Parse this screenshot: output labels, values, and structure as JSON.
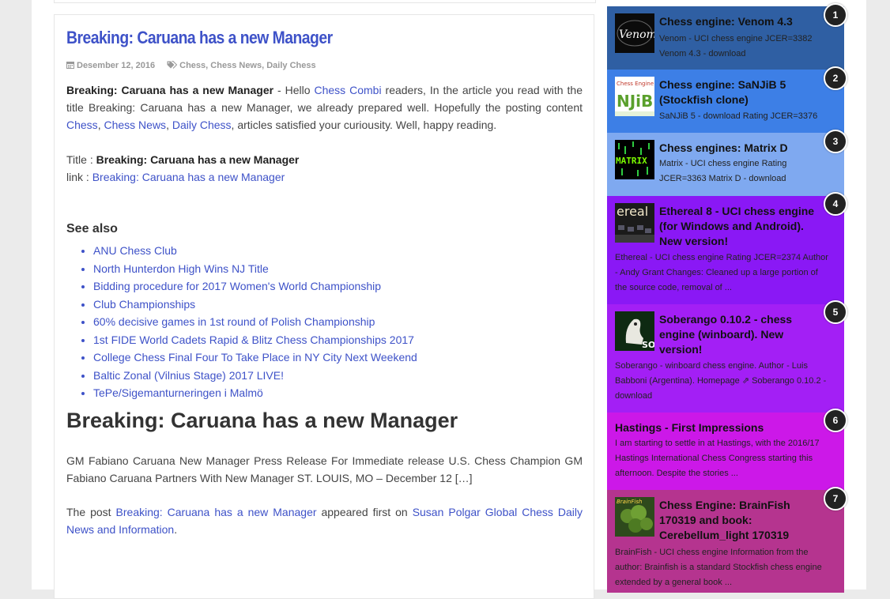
{
  "article": {
    "title": "Breaking: Caruana has a new Manager",
    "date": "Desember 12, 2016",
    "tags": [
      "Chess",
      "Chess News",
      "Daily Chess"
    ],
    "intro": {
      "bold": "Breaking: Caruana has a new Manager",
      "t1": " - Hello ",
      "site": "Chess Combi",
      "t2": " readers, In the article you read with the title Breaking: Caruana has a new Manager, we already prepared well. Hopefully the posting content ",
      "tag1": "Chess",
      "sep1": ", ",
      "tag2": "Chess News",
      "sep2": ", ",
      "tag3": "Daily Chess",
      "t3": ", articles satisfied your curiousity. Well, happy reading."
    },
    "title_label": "Title : ",
    "title_value": "Breaking: Caruana has a new Manager",
    "link_label": "link : ",
    "link_value": "Breaking: Caruana has a new Manager",
    "see_also_title": "See also",
    "see_also": [
      "ANU Chess Club",
      "North Hunterdon High Wins NJ Title",
      "Bidding procedure for 2017 Women's World Championship",
      "Club Championships",
      "60% decisive games in 1st round of Polish Championship",
      "1st FIDE World Cadets Rapid & Blitz Chess Championships 2017",
      "College Chess Final Four To Take Place in NY City Next Weekend",
      "Baltic Zonal (Vilnius Stage) 2017 LIVE!",
      "TePe/Sigemanturneringen i Malmö"
    ],
    "heading": "Breaking: Caruana has a new Manager",
    "body": "GM Fabiano Caruana New Manager Press Release For Immediate release U.S. Chess Champion GM Fabiano Caruana Partners With New Manager ST. LOUIS, MO – December 12 […]",
    "post_prefix": "The post ",
    "post_link": "Breaking: Caruana has a new Manager",
    "post_mid": " appeared first on ",
    "post_source": "Susan Polgar Global Chess Daily News and Information",
    "post_end": "."
  },
  "sidebar": [
    {
      "num": "1",
      "title": "Chess engine: Venom 4.3",
      "desc": "Venom   - UCI chess engine JCER=3382 Venom 4.3 - download",
      "thumb_text": "Venom",
      "color": "#2f5fa3"
    },
    {
      "num": "2",
      "title": "Chess engine: SaNJiB 5 (Stockfish clone)",
      "desc": "SaNJiB 5 - download Rating JCER=3376",
      "thumb_text": "NJiB",
      "color": "#3d7fe6"
    },
    {
      "num": "3",
      "title": "Chess engines: Matrix D",
      "desc": "Matrix   - UCI chess engine Rating JCER=3363 Matrix D - download",
      "thumb_text": "MATRIX",
      "color": "#7fa9f0"
    },
    {
      "num": "4",
      "title": "Ethereal 8 - UCI chess engine (for Windows and Android). New version!",
      "desc": "Ethereal  - UCI chess engine Rating JCER=2374 Author - Andy Grant Changes: Cleaned up a large portion of the source code, removal of ...",
      "thumb_text": "ereal",
      "color": "#8a18f5"
    },
    {
      "num": "5",
      "title": "Soberango 0.10.2 - chess engine (winboard). New version!",
      "desc": "Soberango  - winboard chess engine. Author - Luis Babboni (Argentina). Homepage  ⇗  Soberango 0.10.2 - download",
      "thumb_text": "SO",
      "color": "#a31ff5"
    },
    {
      "num": "6",
      "title": "Hastings - First Impressions",
      "desc": "I am starting to settle in at Hastings, with the 2016/17 Hastings International Chess Congress starting this afternoon. Despite the stories ...",
      "thumb_text": "",
      "color": "#cc18e8"
    },
    {
      "num": "7",
      "title": "Chess Engine: BrainFish 170319 and book: Cerebellum_light 170319",
      "desc": "BrainFish  - UCI chess engine Information from the author: Brainfish  is a standard  Stockfish  chess engine extended by a general book ...",
      "thumb_text": "BrainFish",
      "color": "#b5348f"
    }
  ]
}
